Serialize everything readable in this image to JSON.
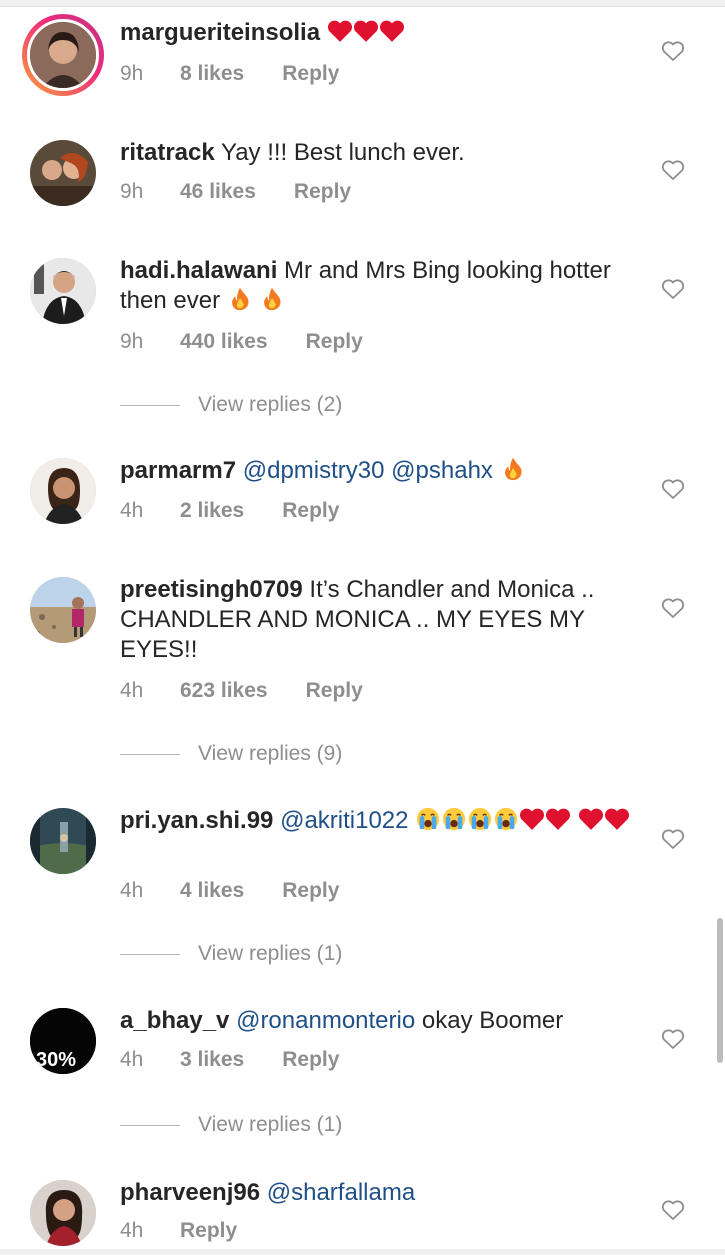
{
  "comments": [
    {
      "username": "margueriteinsolia",
      "text_parts": [],
      "emoji_after": [
        "heart",
        "heart",
        "heart"
      ],
      "time": "9h",
      "likes": "8 likes",
      "reply": "Reply"
    },
    {
      "username": "ritatrack",
      "text": "Yay !!! Best lunch ever.",
      "time": "9h",
      "likes": "46 likes",
      "reply": "Reply"
    },
    {
      "username": "hadi.halawani",
      "text": "Mr and Mrs Bing looking hotter then ever",
      "time": "9h",
      "likes": "440 likes",
      "reply": "Reply",
      "view_replies": "View replies (2)"
    },
    {
      "username": "parmarm7",
      "mention1": "@dpmistry30",
      "mention2": "@pshahx",
      "time": "4h",
      "likes": "2 likes",
      "reply": "Reply"
    },
    {
      "username": "preetisingh0709",
      "text": "It’s Chandler and Monica .. CHANDLER AND MONICA .. MY EYES MY EYES!!",
      "time": "4h",
      "likes": "623 likes",
      "reply": "Reply",
      "view_replies": "View replies (9)"
    },
    {
      "username": "pri.yan.shi.99",
      "mention1": "@akriti1022",
      "time": "4h",
      "likes": "4 likes",
      "reply": "Reply",
      "view_replies": "View replies (1)"
    },
    {
      "username": "a_bhay_v",
      "mention1": "@ronanmonterio",
      "text": "okay Boomer",
      "avatar_text": "30%",
      "time": "4h",
      "likes": "3 likes",
      "reply": "Reply",
      "view_replies": "View replies (1)"
    },
    {
      "username": "pharveenj96",
      "mention1": "@sharfallama",
      "time": "4h",
      "reply": "Reply"
    }
  ],
  "icons": {
    "like": "heart-outline-icon",
    "heart": "red-heart-emoji",
    "fire": "fire-emoji",
    "cry": "loudly-crying-emoji"
  },
  "colors": {
    "mention": "#1f4f88",
    "meta": "#8e8e8e",
    "heart": "#e0102f",
    "text": "#262626"
  }
}
